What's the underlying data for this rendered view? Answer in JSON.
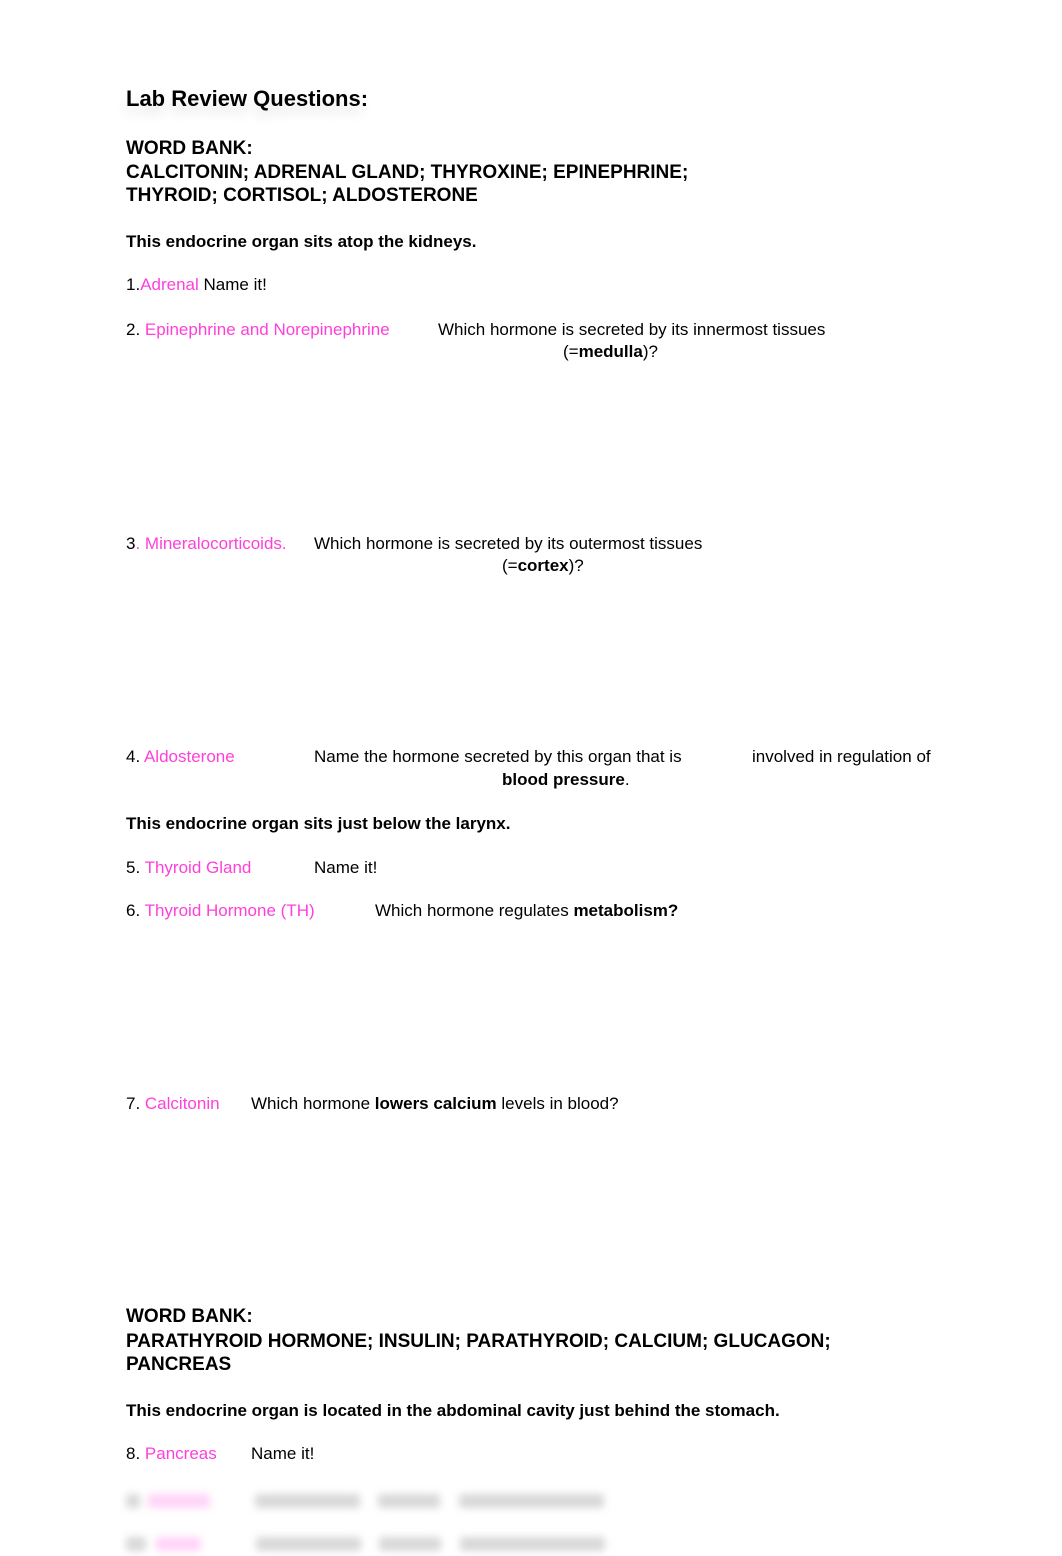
{
  "title": "Lab Review Questions:",
  "word_bank_1": {
    "label": "WORD BANK:",
    "line1": "CALCITONIN; ADRENAL GLAND; THYROXINE; EPINEPHRINE;",
    "line2": "THYROID; CORTISOL; ALDOSTERONE"
  },
  "section_1": {
    "intro": "This endocrine organ sits atop the kidneys.",
    "questions": [
      {
        "number": "1.",
        "answer": "Adrenal",
        "prompt": " Name it!"
      },
      {
        "number": "2. ",
        "answer": "Epinephrine and Norepinephrine",
        "prompt": "Which hormone is secreted by its innermost tissues",
        "cont_pre": "(=",
        "cont_bold": "medulla",
        "cont_post": ")?"
      },
      {
        "number": "3",
        "answer": ". Mineralocorticoids.",
        "prompt": "Which hormone is secreted by its outermost tissues",
        "cont_pre": "(=",
        "cont_bold": "cortex",
        "cont_post": ")?"
      },
      {
        "number": "4. ",
        "answer": "Aldosterone",
        "prompt": "Name the hormone secreted by this organ that is",
        "prompt2": "involved in regulation of",
        "cont_bold": "blood pressure",
        "cont_post": "."
      }
    ]
  },
  "section_2": {
    "intro": "This endocrine organ sits just below the larynx.",
    "questions": [
      {
        "number": "5. ",
        "answer": "Thyroid Gland",
        "prompt": "Name it!"
      },
      {
        "number": "6. ",
        "answer": "Thyroid Hormone (TH)",
        "prompt": "Which hormone regulates ",
        "prompt_bold": "metabolism?"
      },
      {
        "number": "7. ",
        "answer": "Calcitonin",
        "prompt": "Which hormone ",
        "prompt_bold": "lowers calcium",
        "prompt_post": " levels in blood?"
      }
    ]
  },
  "word_bank_2": {
    "label": "WORD BANK:",
    "line1": "PARATHYROID HORMONE; INSULIN; PARATHYROID; CALCIUM; GLUCAGON;",
    "line2": "PANCREAS"
  },
  "section_3": {
    "intro": "This endocrine organ is located in the abdominal cavity just behind the stomach.",
    "questions": [
      {
        "number": "8. ",
        "answer": "Pancreas",
        "prompt": "Name it!"
      }
    ]
  },
  "colors": {
    "answer": "#ff3fd9",
    "text": "#000000"
  }
}
